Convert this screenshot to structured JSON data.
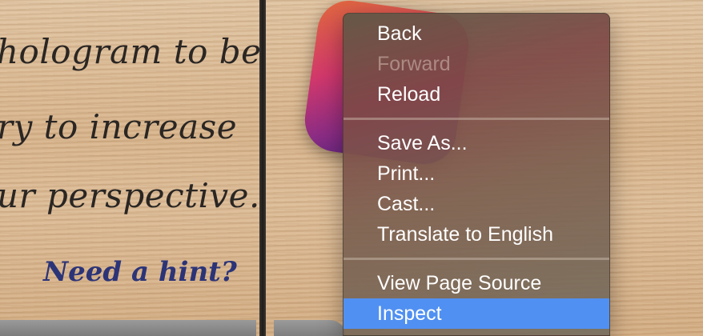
{
  "background": {
    "handwriting_lines": [
      "hologram to be",
      "ry to increase",
      "ur perspective."
    ],
    "hint_link": "Need a hint?"
  },
  "context_menu": {
    "groups": [
      [
        {
          "label": "Back",
          "enabled": true
        },
        {
          "label": "Forward",
          "enabled": false
        },
        {
          "label": "Reload",
          "enabled": true
        }
      ],
      [
        {
          "label": "Save As...",
          "enabled": true
        },
        {
          "label": "Print...",
          "enabled": true
        },
        {
          "label": "Cast...",
          "enabled": true
        },
        {
          "label": "Translate to English",
          "enabled": true
        }
      ],
      [
        {
          "label": "View Page Source",
          "enabled": true
        },
        {
          "label": "Inspect",
          "enabled": true,
          "selected": true
        }
      ]
    ],
    "highlight_color": "#5090f2"
  }
}
